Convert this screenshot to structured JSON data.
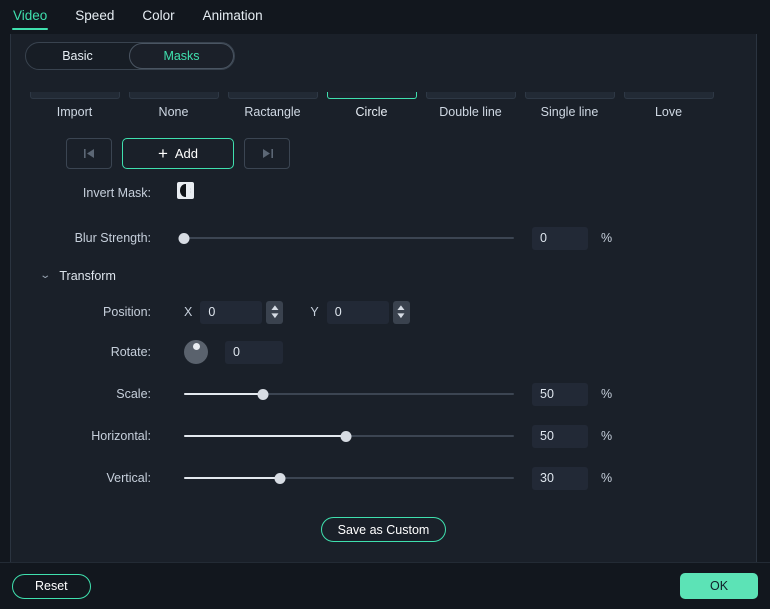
{
  "top_tabs": [
    {
      "label": "Video",
      "active": true
    },
    {
      "label": "Speed",
      "active": false
    },
    {
      "label": "Color",
      "active": false
    },
    {
      "label": "Animation",
      "active": false
    }
  ],
  "segmented": {
    "basic_label": "Basic",
    "masks_label": "Masks",
    "active": "Masks"
  },
  "mask_presets": [
    {
      "label": "Import",
      "selected": false
    },
    {
      "label": "None",
      "selected": false
    },
    {
      "label": "Ractangle",
      "selected": false
    },
    {
      "label": "Circle",
      "selected": true
    },
    {
      "label": "Double line",
      "selected": false
    },
    {
      "label": "Single line",
      "selected": false
    },
    {
      "label": "Love",
      "selected": false
    }
  ],
  "keyframe_bar": {
    "prev_icon": "skip-previous-icon",
    "add_label": "Add",
    "add_icon": "plus-icon",
    "next_icon": "skip-next-icon"
  },
  "invert_mask": {
    "label": "Invert Mask:",
    "icon": "invert-contrast-icon",
    "enabled": false
  },
  "blur_strength": {
    "label": "Blur Strength:",
    "value": "0",
    "unit": "%",
    "percent": 0
  },
  "transform": {
    "title": "Transform",
    "expanded": true,
    "chevron_icon": "chevron-down-icon",
    "position": {
      "label": "Position:",
      "x_axis_label": "X",
      "x_value": "0",
      "y_axis_label": "Y",
      "y_value": "0"
    },
    "rotate": {
      "label": "Rotate:",
      "value": "0",
      "dial_icon": "rotation-dial-icon"
    },
    "scale": {
      "label": "Scale:",
      "value": "50",
      "unit": "%",
      "percent": 24
    },
    "horizontal": {
      "label": "Horizontal:",
      "value": "50",
      "unit": "%",
      "percent": 49
    },
    "vertical": {
      "label": "Vertical:",
      "value": "30",
      "unit": "%",
      "percent": 29
    }
  },
  "save_as_custom_label": "Save as Custom",
  "footer": {
    "reset_label": "Reset",
    "ok_label": "OK"
  },
  "colors": {
    "accent": "#3fe0ae",
    "ok_button": "#5ce3b6",
    "panel_bg": "#1a2029",
    "window_bg": "#12171e",
    "field_bg": "#222936"
  }
}
